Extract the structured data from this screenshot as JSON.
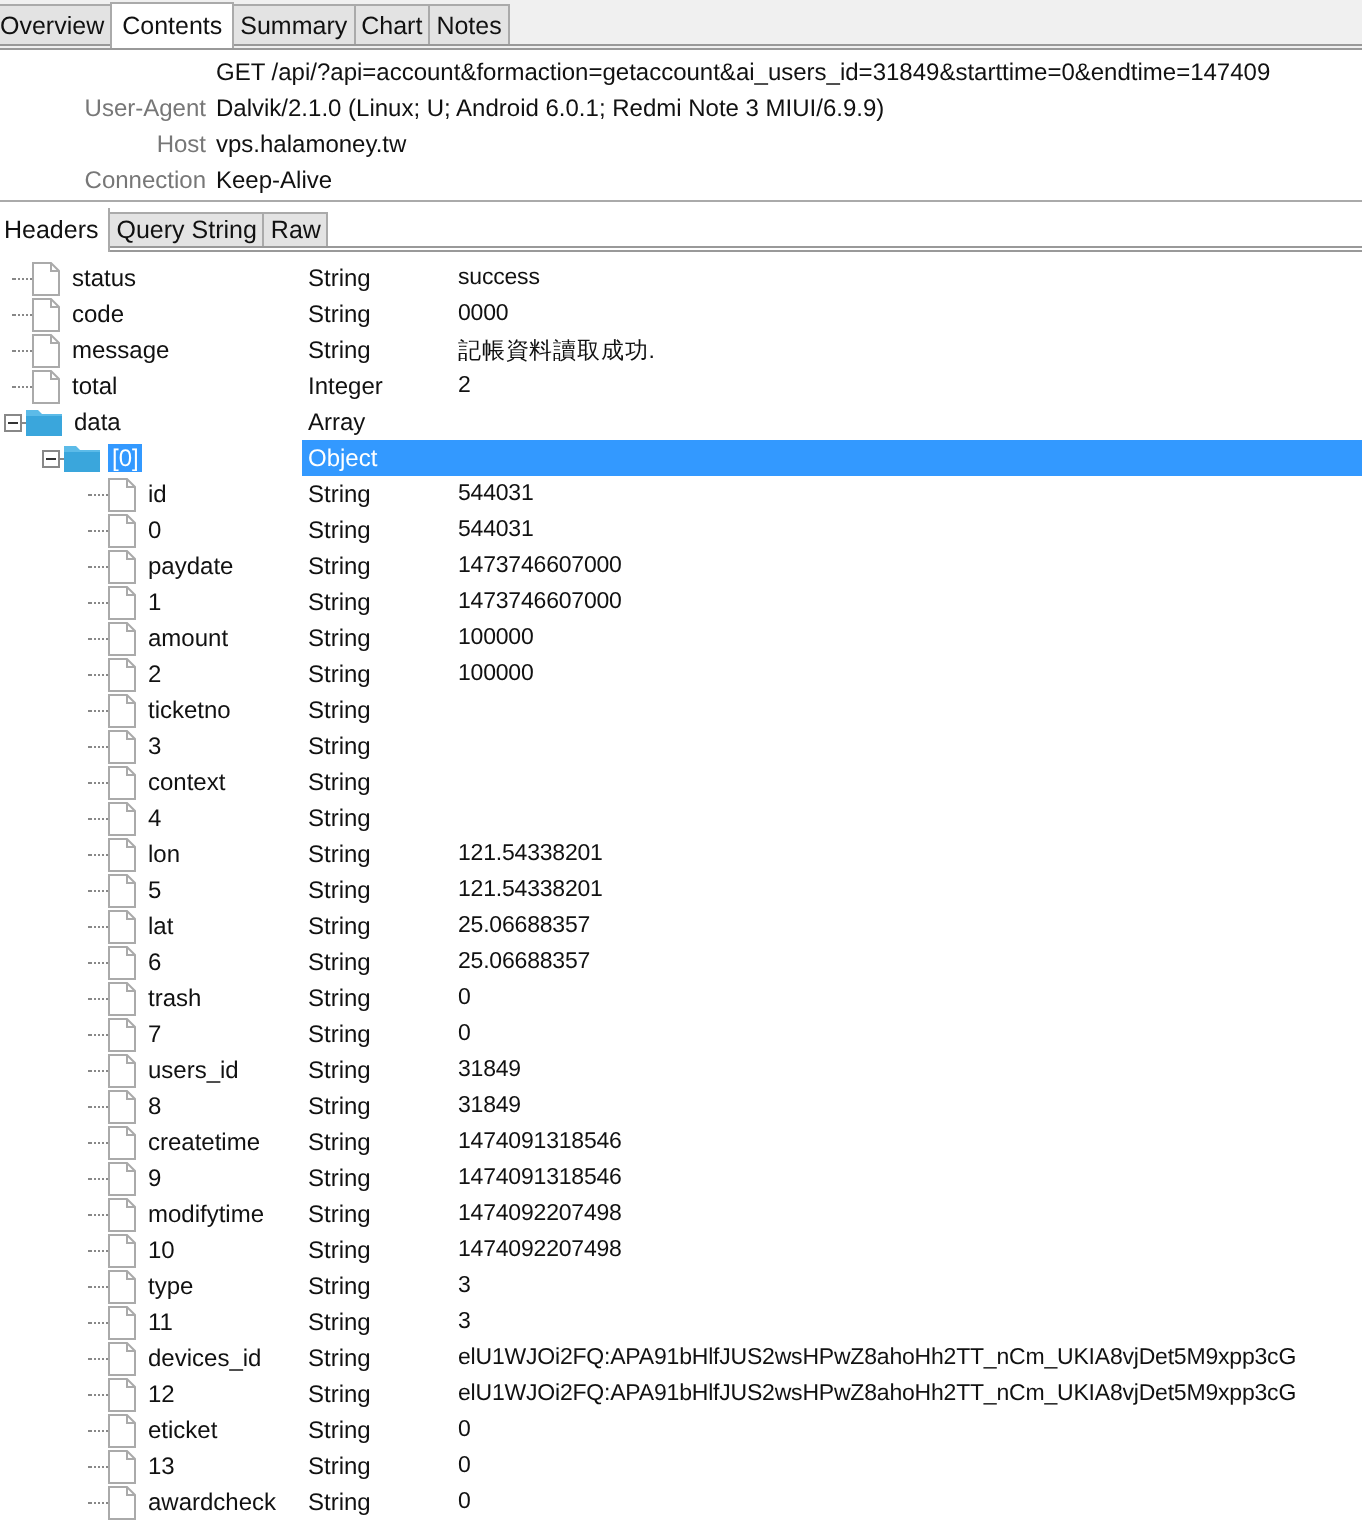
{
  "tabs": [
    {
      "label": "Overview",
      "selected": false
    },
    {
      "label": "Contents",
      "selected": true
    },
    {
      "label": "Summary",
      "selected": false
    },
    {
      "label": "Chart",
      "selected": false
    },
    {
      "label": "Notes",
      "selected": false
    }
  ],
  "headers": [
    {
      "value": "GET /api/?api=account&formaction=getaccount&ai_users_id=31849&starttime=0&endtime=147409"
    },
    {
      "name": "User-Agent",
      "value": "Dalvik/2.1.0 (Linux; U; Android 6.0.1; Redmi Note 3 MIUI/6.9.9)"
    },
    {
      "name": "Host",
      "value": "vps.halamoney.tw"
    },
    {
      "name": "Connection",
      "value": "Keep-Alive"
    }
  ],
  "sub_tabs": [
    {
      "label": "Headers",
      "selected": true
    },
    {
      "label": "Query String",
      "selected": false
    },
    {
      "label": "Raw",
      "selected": false
    }
  ],
  "tree": [
    {
      "name": "status",
      "type": "String",
      "value": "success",
      "selected": false
    },
    {
      "name": "code",
      "type": "String",
      "value": "0000",
      "selected": false
    },
    {
      "name": "message",
      "type": "String",
      "value": "記帳資料讀取成功.",
      "selected": false
    },
    {
      "name": "total",
      "type": "Integer",
      "value": "2",
      "selected": false
    },
    {
      "name": "data",
      "type": "Array",
      "selected": false,
      "expanded": true,
      "children": [
        {
          "name": "[0]",
          "type": "Object",
          "selected": true,
          "expanded": true,
          "children": [
            {
              "name": "id",
              "type": "String",
              "value": "544031",
              "selected": false
            },
            {
              "name": "0",
              "type": "String",
              "value": "544031",
              "selected": false
            },
            {
              "name": "paydate",
              "type": "String",
              "value": "1473746607000",
              "selected": false
            },
            {
              "name": "1",
              "type": "String",
              "value": "1473746607000",
              "selected": false
            },
            {
              "name": "amount",
              "type": "String",
              "value": "100000",
              "selected": false
            },
            {
              "name": "2",
              "type": "String",
              "value": "100000",
              "selected": false
            },
            {
              "name": "ticketno",
              "type": "String",
              "selected": false
            },
            {
              "name": "3",
              "type": "String",
              "selected": false
            },
            {
              "name": "context",
              "type": "String",
              "selected": false
            },
            {
              "name": "4",
              "type": "String",
              "selected": false
            },
            {
              "name": "lon",
              "type": "String",
              "value": "121.54338201",
              "selected": false
            },
            {
              "name": "5",
              "type": "String",
              "value": "121.54338201",
              "selected": false
            },
            {
              "name": "lat",
              "type": "String",
              "value": "25.06688357",
              "selected": false
            },
            {
              "name": "6",
              "type": "String",
              "value": "25.06688357",
              "selected": false
            },
            {
              "name": "trash",
              "type": "String",
              "value": "0",
              "selected": false
            },
            {
              "name": "7",
              "type": "String",
              "value": "0",
              "selected": false
            },
            {
              "name": "users_id",
              "type": "String",
              "value": "31849",
              "selected": false
            },
            {
              "name": "8",
              "type": "String",
              "value": "31849",
              "selected": false
            },
            {
              "name": "createtime",
              "type": "String",
              "value": "1474091318546",
              "selected": false
            },
            {
              "name": "9",
              "type": "String",
              "value": "1474091318546",
              "selected": false
            },
            {
              "name": "modifytime",
              "type": "String",
              "value": "1474092207498",
              "selected": false
            },
            {
              "name": "10",
              "type": "String",
              "value": "1474092207498",
              "selected": false
            },
            {
              "name": "type",
              "type": "String",
              "value": "3",
              "selected": false
            },
            {
              "name": "11",
              "type": "String",
              "value": "3",
              "selected": false
            },
            {
              "name": "devices_id",
              "type": "String",
              "value": "elU1WJOi2FQ:APA91bHlfJUS2wsHPwZ8ahoHh2TT_nCm_UKIA8vjDet5M9xpp3cG",
              "selected": false
            },
            {
              "name": "12",
              "type": "String",
              "value": "elU1WJOi2FQ:APA91bHlfJUS2wsHPwZ8ahoHh2TT_nCm_UKIA8vjDet5M9xpp3cG",
              "selected": false
            },
            {
              "name": "eticket",
              "type": "String",
              "value": "0",
              "selected": false
            },
            {
              "name": "13",
              "type": "String",
              "value": "0",
              "selected": false
            },
            {
              "name": "awardcheck",
              "type": "String",
              "value": "0",
              "selected": false
            }
          ]
        }
      ]
    }
  ]
}
